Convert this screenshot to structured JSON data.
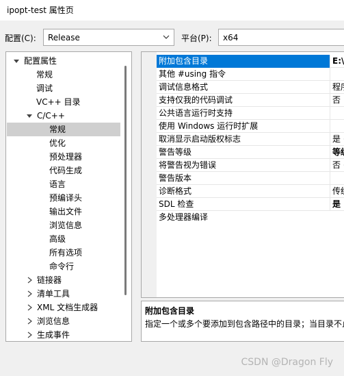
{
  "window": {
    "title": "ipopt-test 属性页"
  },
  "config": {
    "label": "配置(C):",
    "value": "Release",
    "platform_label": "平台(P):",
    "platform_value": "x64"
  },
  "tree": [
    {
      "label": "配置属性",
      "expanded": true
    },
    {
      "label": "常规"
    },
    {
      "label": "调试"
    },
    {
      "label": "VC++ 目录"
    },
    {
      "label": "C/C++",
      "expanded": true
    },
    {
      "label": "常规",
      "selected": true
    },
    {
      "label": "优化"
    },
    {
      "label": "预处理器"
    },
    {
      "label": "代码生成"
    },
    {
      "label": "语言"
    },
    {
      "label": "预编译头"
    },
    {
      "label": "输出文件"
    },
    {
      "label": "浏览信息"
    },
    {
      "label": "高级"
    },
    {
      "label": "所有选项"
    },
    {
      "label": "命令行"
    },
    {
      "label": "链接器",
      "collapsed": true
    },
    {
      "label": "清单工具",
      "collapsed": true
    },
    {
      "label": "XML 文档生成器",
      "collapsed": true
    },
    {
      "label": "浏览信息",
      "collapsed": true
    },
    {
      "label": "生成事件",
      "collapsed": true
    }
  ],
  "properties": [
    {
      "name": "附加包含目录",
      "value": "E:\\工",
      "selected": true
    },
    {
      "name": "其他 #using 指令",
      "value": ""
    },
    {
      "name": "调试信息格式",
      "value": "程序"
    },
    {
      "name": "支持仅我的代码调试",
      "value": "否"
    },
    {
      "name": "公共语言运行时支持",
      "value": ""
    },
    {
      "name": "使用 Windows 运行时扩展",
      "value": ""
    },
    {
      "name": "取消显示启动版权标志",
      "value": "是 ("
    },
    {
      "name": "警告等级",
      "value": "等级",
      "bold": true
    },
    {
      "name": "将警告视为错误",
      "value": "否 ("
    },
    {
      "name": "警告版本",
      "value": ""
    },
    {
      "name": "诊断格式",
      "value": "传统"
    },
    {
      "name": "SDL 检查",
      "value": "是 (",
      "bold": true
    },
    {
      "name": "多处理器编译",
      "value": ""
    }
  ],
  "description": {
    "title": "附加包含目录",
    "text": "指定一个或多个要添加到包含路径中的目录；当目录不止"
  },
  "watermark": "CSDN @Dragon Fly"
}
